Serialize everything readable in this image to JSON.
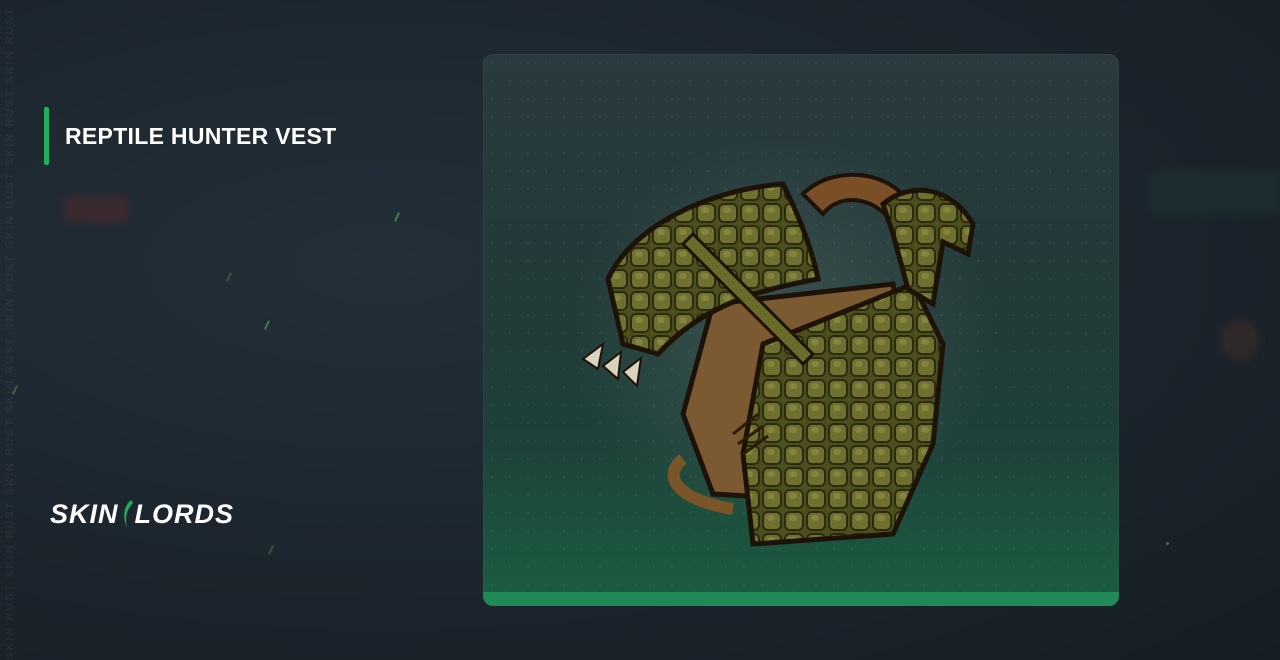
{
  "item": {
    "name": "REPTILE HUNTER VEST",
    "image_icon": "reptile-hunter-vest-image",
    "rarity_color": "#1f8a55"
  },
  "brand": {
    "logo_left": "SKIN",
    "logo_right": "LORDS",
    "accent_color": "#1fb05b"
  },
  "watermark": {
    "text": "SKIN RUST SKIN RUST SKIN RUST SKIN RUST SKIN RUST SKIN RUST SKIN RUST SKIN RUST SKIN RUST"
  }
}
